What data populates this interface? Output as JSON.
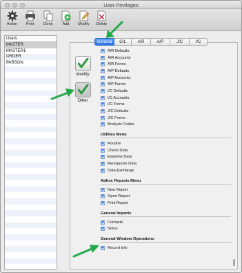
{
  "window": {
    "title": "User Privileges"
  },
  "toolbar": {
    "buttons": [
      {
        "label": "Action",
        "icon": "gear-icon"
      },
      {
        "label": "Print",
        "icon": "printer-icon"
      },
      {
        "label": "Clone",
        "icon": "clone-icon"
      },
      {
        "label": "Add",
        "icon": "add-icon"
      },
      {
        "label": "Modify",
        "icon": "modify-icon"
      },
      {
        "label": "Delete",
        "icon": "delete-icon"
      }
    ]
  },
  "users": {
    "header": "Users",
    "items": [
      "MASTER",
      "MASTER1",
      "ORDER",
      "PARSON"
    ],
    "selected": "MASTER"
  },
  "tabs": {
    "items": [
      "General",
      "G/L",
      "A/R",
      "A/P",
      "J/C",
      "I/C"
    ],
    "active": "General"
  },
  "side_buttons": {
    "identity": "Identity",
    "other": "Other"
  },
  "privileges": {
    "top_items": [
      "A/R Defaults",
      "A/R Accounts",
      "A/R Forms",
      "A/P Defaults",
      "A/P Accounts",
      "A/P Forms",
      "I/C Defaults",
      "I/C Accounts",
      "I/C Forms",
      "J/C Defaults",
      "J/C Forms",
      "Analysis Codes"
    ],
    "sections": [
      {
        "title": "Utilities Menu",
        "items": [
          "Routine",
          "Check Data",
          "Examine Data",
          "Reorganize Data",
          "Data Exchange"
        ]
      },
      {
        "title": "Adhoc Reports Menu",
        "items": [
          "New Report",
          "Open Report",
          "Print Report"
        ]
      },
      {
        "title": "General Imports",
        "items": [
          "Contacts",
          "Notes"
        ]
      },
      {
        "title": "General Window Operations",
        "items": [
          "Record Info"
        ]
      }
    ]
  },
  "colors": {
    "accent": "#2a72e0",
    "arrow": "#22a84a",
    "checkbox": "#4f8ef0"
  }
}
